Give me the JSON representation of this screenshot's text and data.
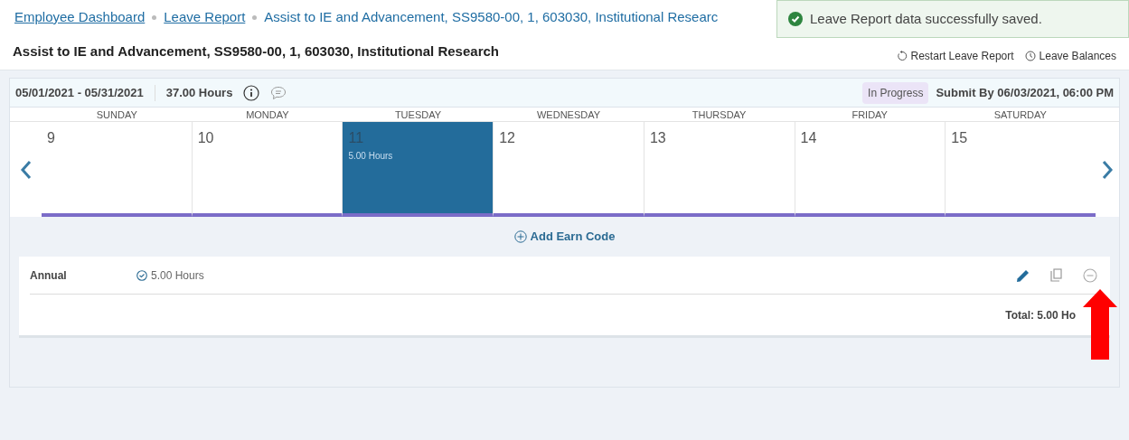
{
  "breadcrumb": [
    {
      "label": "Employee Dashboard",
      "kind": "link"
    },
    {
      "label": "Leave Report",
      "kind": "link"
    },
    {
      "label": "Assist to IE and Advancement, SS9580-00, 1, 603030, Institutional Researc",
      "kind": "current"
    }
  ],
  "toast": {
    "message": "Leave Report data successfully saved."
  },
  "title": "Assist to IE and Advancement, SS9580-00, 1, 603030, Institutional Research",
  "actions": [
    {
      "label": "Restart Leave Report",
      "kind": "restart"
    },
    {
      "label": "Leave Balances",
      "kind": "balances"
    }
  ],
  "period": {
    "range": "05/01/2021 - 05/31/2021",
    "hours": "37.00 Hours",
    "status": "In Progress",
    "submit_by": "Submit By 06/03/2021, 06:00 PM"
  },
  "days": [
    {
      "weekday": "SUNDAY",
      "date": "9",
      "selected": false
    },
    {
      "weekday": "MONDAY",
      "date": "10",
      "selected": false
    },
    {
      "weekday": "TUESDAY",
      "date": "11",
      "selected": true,
      "entry": "5.00 Hours"
    },
    {
      "weekday": "WEDNESDAY",
      "date": "12",
      "selected": false
    },
    {
      "weekday": "THURSDAY",
      "date": "13",
      "selected": false
    },
    {
      "weekday": "FRIDAY",
      "date": "14",
      "selected": false
    },
    {
      "weekday": "SATURDAY",
      "date": "15",
      "selected": false
    }
  ],
  "add_earn_code": "Add Earn Code",
  "earn_codes": [
    {
      "name": "Annual",
      "hours": "5.00 Hours"
    }
  ],
  "total": "Total: 5.00 Ho"
}
